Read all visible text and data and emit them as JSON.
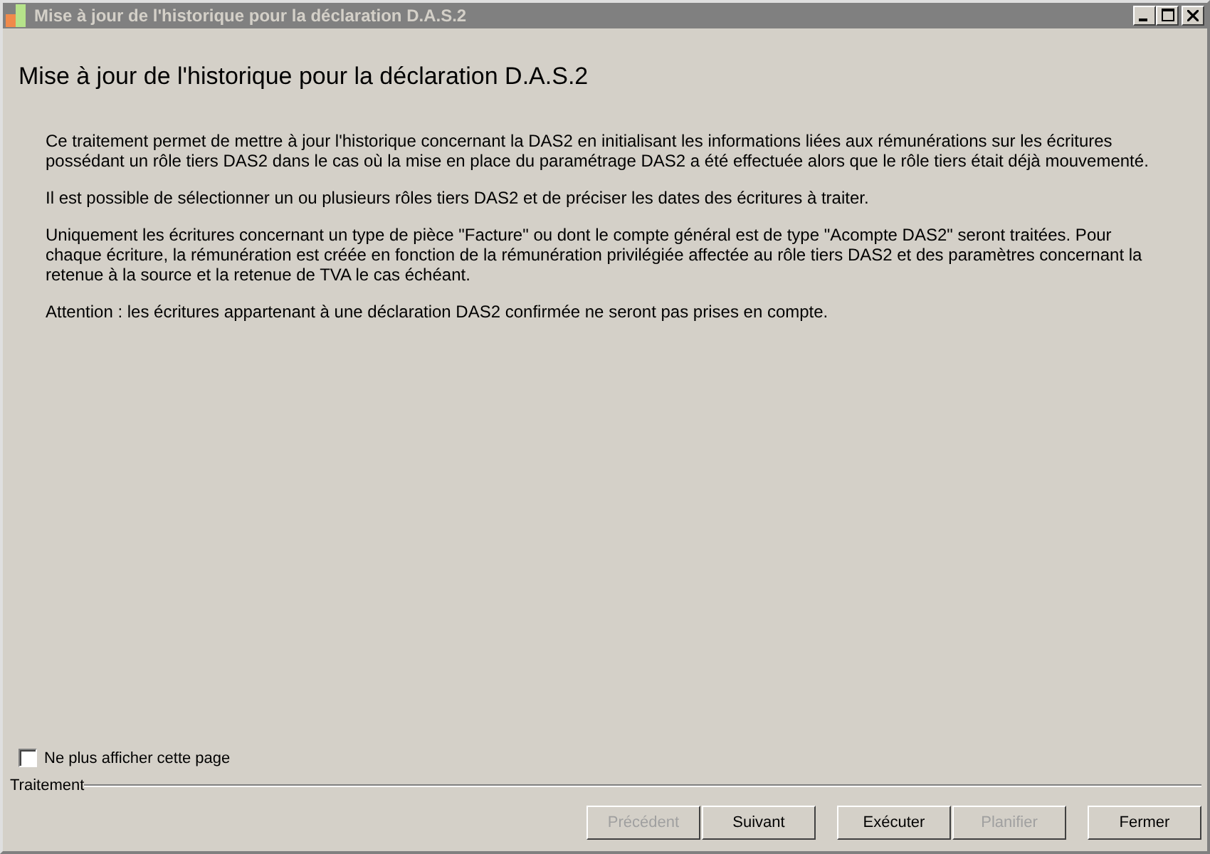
{
  "window": {
    "title": "Mise à jour de l'historique pour la déclaration D.A.S.2"
  },
  "heading": "Mise à jour de l'historique pour la déclaration D.A.S.2",
  "paragraphs": [
    "Ce traitement permet de mettre à jour l'historique concernant la DAS2 en initialisant les informations liées aux rémunérations sur les écritures possédant un rôle tiers DAS2 dans le cas où la mise en place du paramétrage DAS2 a été effectuée alors que le rôle tiers était déjà mouvementé.",
    "Il est possible de sélectionner un ou plusieurs rôles tiers DAS2 et de préciser les dates des écritures à traiter.",
    "Uniquement les écritures concernant un type de pièce \"Facture\" ou dont le compte général est de type \"Acompte DAS2\" seront traitées. Pour chaque écriture, la rémunération est créée en fonction de la rémunération privilégiée affectée au rôle tiers DAS2 et des paramètres concernant la retenue à la source et la retenue de TVA le cas échéant.",
    "Attention : les écritures appartenant à une déclaration DAS2 confirmée ne seront pas prises en compte."
  ],
  "checkbox": {
    "label": "Ne plus afficher cette page",
    "checked": false
  },
  "group_label": "Traitement",
  "button_groups": [
    [
      {
        "label": "Précédent",
        "disabled": true
      },
      {
        "label": "Suivant",
        "disabled": false
      }
    ],
    [
      {
        "label": "Exécuter",
        "disabled": false
      },
      {
        "label": "Planifier",
        "disabled": true
      }
    ],
    [
      {
        "label": "Fermer",
        "disabled": false
      }
    ]
  ]
}
